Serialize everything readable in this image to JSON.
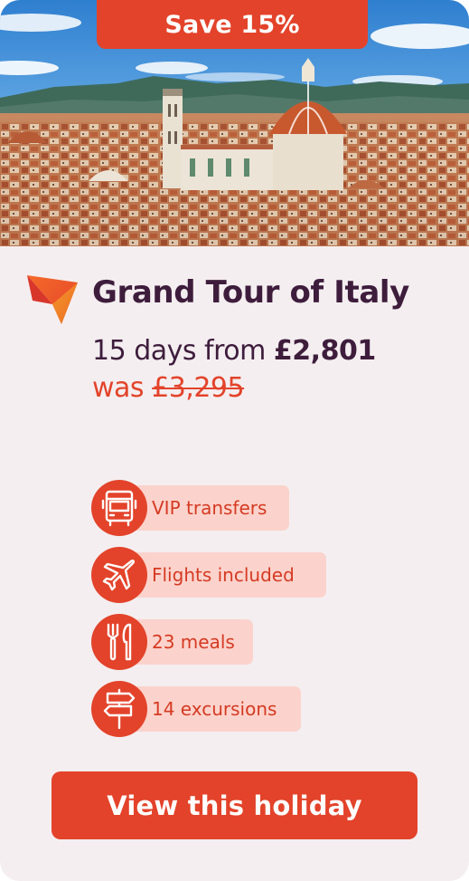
{
  "badge": {
    "label": "Save 15%"
  },
  "hero": {
    "image_alt": "Florence skyline with cathedral dome"
  },
  "title": "Grand Tour of Italy",
  "price": {
    "prefix": "15 days from",
    "amount": "£2,801",
    "was_prefix": "was",
    "was_amount": "£3,295"
  },
  "features": [
    {
      "icon": "bus-icon",
      "label": "VIP transfers"
    },
    {
      "icon": "plane-icon",
      "label": "Flights included"
    },
    {
      "icon": "fork-knife-icon",
      "label": "23 meals"
    },
    {
      "icon": "signpost-icon",
      "label": "14 excursions"
    }
  ],
  "cta": {
    "label": "View this holiday"
  },
  "colors": {
    "accent": "#e3432a",
    "title": "#3e1d3c",
    "card_bg": "#f4eef0",
    "pill_bg": "#fbd3cc"
  }
}
